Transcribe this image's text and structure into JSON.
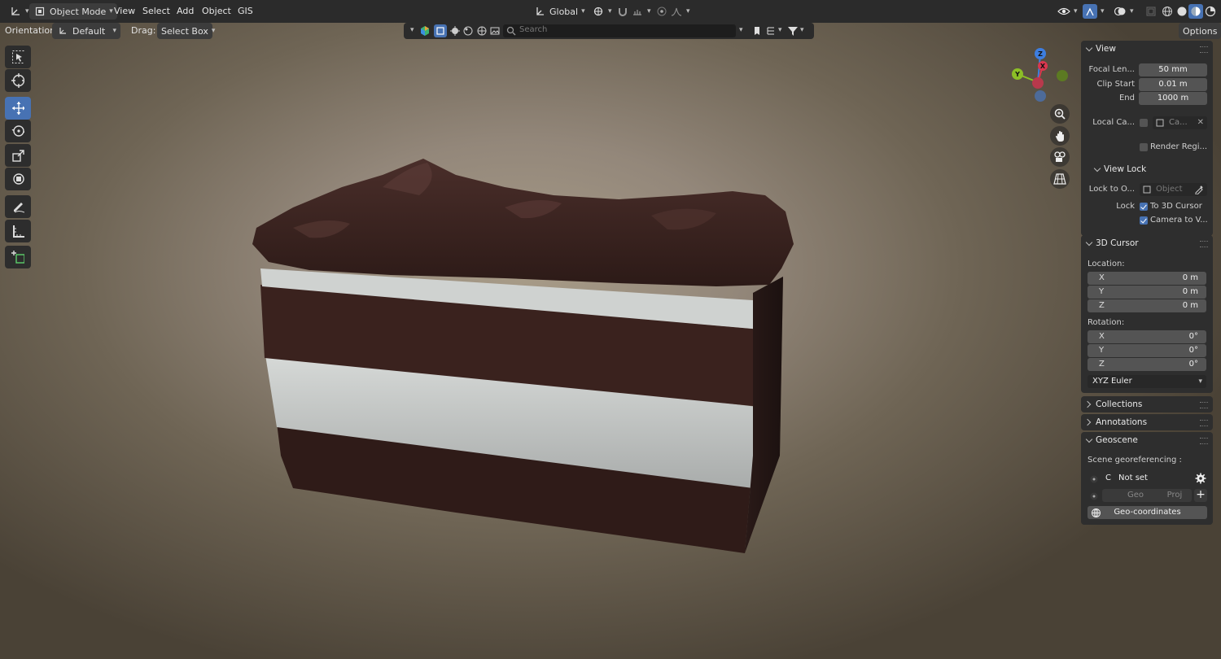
{
  "header": {
    "mode": "Object Mode",
    "menus": [
      "View",
      "Select",
      "Add",
      "Object",
      "GIS"
    ],
    "transform_orientation": "Global",
    "options_label": "Options"
  },
  "tool_header": {
    "orientation_label": "Orientation:",
    "orientation_value": "Default",
    "drag_label": "Drag:",
    "drag_value": "Select Box",
    "search_placeholder": "Search"
  },
  "gizmo": {
    "z": "Z",
    "y": "Y",
    "x": "X"
  },
  "sidebar": {
    "view": {
      "title": "View",
      "focal_length_label": "Focal Len...",
      "focal_length": "50 mm",
      "clip_start_label": "Clip Start",
      "clip_start": "0.01 m",
      "end_label": "End",
      "end": "1000 m",
      "local_camera_label": "Local Ca...",
      "local_camera_value": "Ca...",
      "render_region_label": "Render Regi...",
      "view_lock_title": "View Lock",
      "lock_to_object_label": "Lock to O...",
      "lock_to_object_placeholder": "Object",
      "lock_label": "Lock",
      "to_3d_cursor": "To 3D Cursor",
      "camera_to_view": "Camera to V..."
    },
    "cursor": {
      "title": "3D Cursor",
      "location_label": "Location:",
      "location": [
        {
          "axis": "X",
          "value": "0 m"
        },
        {
          "axis": "Y",
          "value": "0 m"
        },
        {
          "axis": "Z",
          "value": "0 m"
        }
      ],
      "rotation_label": "Rotation:",
      "rotation": [
        {
          "axis": "X",
          "value": "0°"
        },
        {
          "axis": "Y",
          "value": "0°"
        },
        {
          "axis": "Z",
          "value": "0°"
        }
      ],
      "rotation_mode": "XYZ Euler"
    },
    "collections_title": "Collections",
    "annotations_title": "Annotations",
    "geoscene": {
      "title": "Geoscene",
      "georef_label": "Scene georeferencing :",
      "c_label": "C",
      "status": "Not set",
      "geo_label": "Geo",
      "proj_label": "Proj",
      "geo_coords_button": "Geo-coordinates"
    }
  },
  "colors": {
    "accent": "#4772b3",
    "header_bg": "#2b2b2b",
    "panel_bg": "#2e2e2e",
    "field_bg": "#545454",
    "axis_x": "#d9374f",
    "axis_y": "#8cbf26",
    "axis_z": "#3d7ee0"
  }
}
